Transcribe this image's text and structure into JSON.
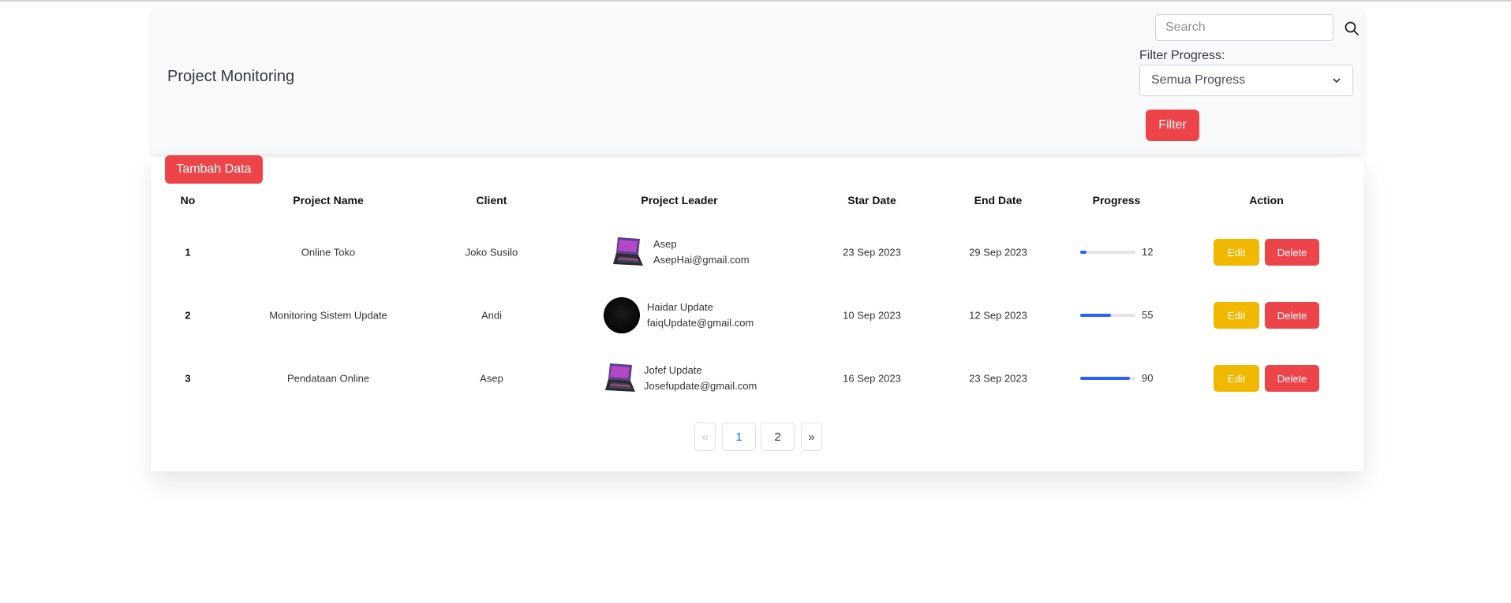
{
  "header": {
    "title": "Project Monitoring",
    "search_placeholder": "Search",
    "filter_label": "Filter Progress:",
    "filter_selected": "Semua Progress",
    "filter_button": "Filter"
  },
  "table": {
    "add_button": "Tambah Data",
    "columns": [
      "No",
      "Project Name",
      "Client",
      "Project Leader",
      "Star Date",
      "End Date",
      "Progress",
      "Action"
    ],
    "rows": [
      {
        "no": "1",
        "project": "Online Toko",
        "client": "Joko Susilo",
        "leader_name": "Asep",
        "leader_email": "AsepHai@gmail.com",
        "avatar": "laptop-avatar",
        "start": "23 Sep 2023",
        "end": "29 Sep 2023",
        "progress": 12
      },
      {
        "no": "2",
        "project": "Monitoring Sistem Update",
        "client": "Andi",
        "leader_name": "Haidar Update",
        "leader_email": "faiqUpdate@gmail.com",
        "avatar": "dark-avatar",
        "start": "10 Sep 2023",
        "end": "12 Sep 2023",
        "progress": 55
      },
      {
        "no": "3",
        "project": "Pendataan Online",
        "client": "Asep",
        "leader_name": "Jofef Update",
        "leader_email": "Josefupdate@gmail.com",
        "avatar": "laptop-avatar",
        "start": "16 Sep 2023",
        "end": "23 Sep 2023",
        "progress": 90
      }
    ],
    "edit_label": "Edit",
    "delete_label": "Delete",
    "progress_color": "#2962ff"
  },
  "pagination": {
    "prev": "«",
    "pages": [
      "1",
      "2"
    ],
    "active": "1",
    "next": "»"
  },
  "colors": {
    "primary_red": "#ec4448",
    "edit_yellow": "#f0b800",
    "active_page_blue": "#0d6efd"
  }
}
